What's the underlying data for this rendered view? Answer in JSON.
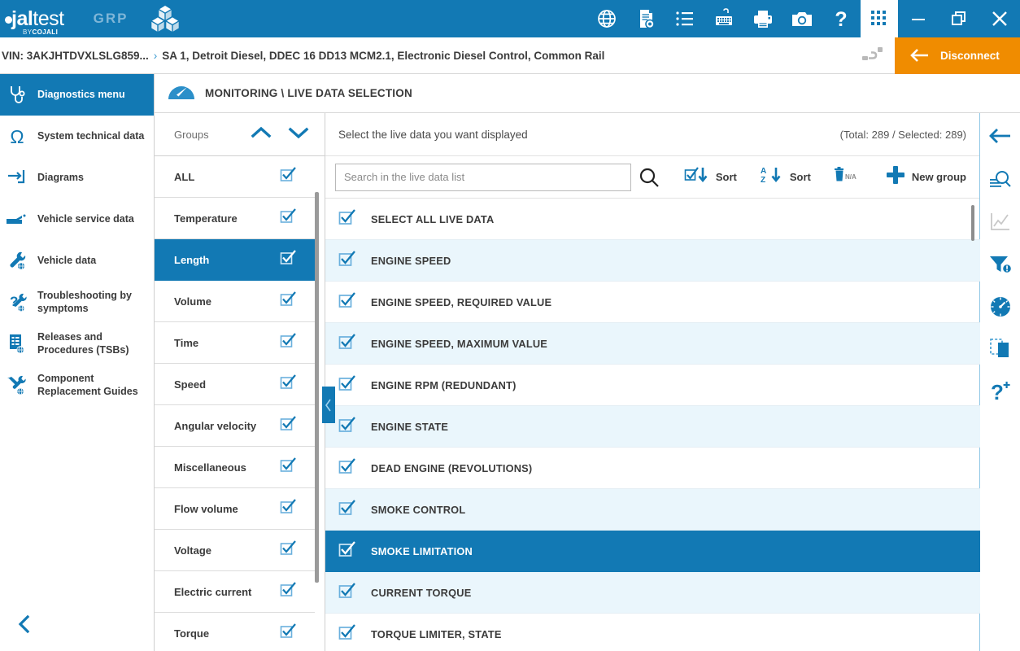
{
  "brand": {
    "logo_dot": "●",
    "logo_bold": "jal",
    "logo_light": "test",
    "logo_by": "BY",
    "logo_cojali": "COJALI",
    "grp": "GRP"
  },
  "titlebar": {
    "icons": [
      {
        "name": "globe-icon",
        "label": "Language"
      },
      {
        "name": "document-search-icon",
        "label": "Documents"
      },
      {
        "name": "list-icon",
        "label": "List"
      },
      {
        "name": "keyboard-icon",
        "label": "Virtual keyboard"
      },
      {
        "name": "printer-icon",
        "label": "Print"
      },
      {
        "name": "camera-icon",
        "label": "Screenshot"
      },
      {
        "name": "help-icon",
        "label": "Help"
      },
      {
        "name": "apps-grid-icon",
        "label": "Apps"
      }
    ],
    "window_controls": [
      {
        "name": "minimize-button",
        "label": "Minimize"
      },
      {
        "name": "restore-button",
        "label": "Restore"
      },
      {
        "name": "close-button",
        "label": "Close"
      }
    ]
  },
  "breadcrumb": {
    "vin": "VIN: 3AKJHTDVXLSLG859...",
    "separator": "›",
    "system": "SA 1, Detroit Diesel, DDEC 16 DD13 MCM2.1, Electronic Diesel Control, Common Rail",
    "connection_icon": "obd-connector-icon",
    "disconnect_label": "Disconnect"
  },
  "sidebar": {
    "items": [
      {
        "label": "Diagnostics menu",
        "icon": "stethoscope-icon",
        "active": true
      },
      {
        "label": "System technical data",
        "icon": "ohm-icon",
        "active": false
      },
      {
        "label": "Diagrams",
        "icon": "diagram-icon",
        "active": false
      },
      {
        "label": "Vehicle service data",
        "icon": "oil-can-icon",
        "active": false
      },
      {
        "label": "Vehicle data",
        "icon": "wrench-globe-icon",
        "active": false
      },
      {
        "label": "Troubleshooting by symptoms",
        "icon": "question-wrench-icon",
        "active": false
      },
      {
        "label": "Releases and Procedures (TSBs)",
        "icon": "document-globe-icon",
        "active": false
      },
      {
        "label": "Component Replacement Guides",
        "icon": "tools-globe-icon",
        "active": false
      }
    ],
    "collapse_icon": "chevron-left-icon"
  },
  "monitoring": {
    "icon": "gauge-icon",
    "title": "MONITORING \\ LIVE DATA SELECTION"
  },
  "groups_panel": {
    "header_label": "Groups",
    "scroll_up_icon": "chevron-up-icon",
    "scroll_down_icon": "chevron-down-icon",
    "items": [
      {
        "label": "ALL",
        "checked": true,
        "active": false
      },
      {
        "label": "Temperature",
        "checked": true,
        "active": false
      },
      {
        "label": "Length",
        "checked": true,
        "active": true
      },
      {
        "label": "Volume",
        "checked": true,
        "active": false
      },
      {
        "label": "Time",
        "checked": true,
        "active": false
      },
      {
        "label": "Speed",
        "checked": true,
        "active": false
      },
      {
        "label": "Angular velocity",
        "checked": true,
        "active": false
      },
      {
        "label": "Miscellaneous",
        "checked": true,
        "active": false
      },
      {
        "label": "Flow volume",
        "checked": true,
        "active": false
      },
      {
        "label": "Voltage",
        "checked": true,
        "active": false
      },
      {
        "label": "Electric current",
        "checked": true,
        "active": false
      },
      {
        "label": "Torque",
        "checked": true,
        "active": false
      }
    ]
  },
  "main_panel": {
    "instruction": "Select the live data you want displayed",
    "count_text": "(Total: 289 / Selected: 289)",
    "search_placeholder": "Search in the live data list",
    "search_value": "",
    "search_icon": "magnifier-icon",
    "tools": [
      {
        "label": "Sort",
        "icon": "sort-by-check-icon",
        "name": "sort-by-selection-button"
      },
      {
        "label": "Sort",
        "icon": "sort-alpha-icon",
        "name": "sort-alphabetical-button"
      },
      {
        "label": "",
        "icon": "trash-na-icon",
        "name": "delete-group-button",
        "badge": "N/A"
      },
      {
        "label": "New group",
        "icon": "plus-icon",
        "name": "new-group-button"
      }
    ],
    "collapse_handle_icon": "chevron-left-icon",
    "rows": [
      {
        "label": "SELECT ALL LIVE DATA",
        "checked": true,
        "shade": false,
        "selected": false
      },
      {
        "label": "ENGINE SPEED",
        "checked": true,
        "shade": true,
        "selected": false
      },
      {
        "label": "ENGINE SPEED, REQUIRED VALUE",
        "checked": true,
        "shade": false,
        "selected": false
      },
      {
        "label": "ENGINE SPEED, MAXIMUM VALUE",
        "checked": true,
        "shade": true,
        "selected": false
      },
      {
        "label": "ENGINE RPM (REDUNDANT)",
        "checked": true,
        "shade": false,
        "selected": false
      },
      {
        "label": "ENGINE STATE",
        "checked": true,
        "shade": true,
        "selected": false
      },
      {
        "label": "DEAD ENGINE (REVOLUTIONS)",
        "checked": true,
        "shade": false,
        "selected": false
      },
      {
        "label": "SMOKE CONTROL",
        "checked": true,
        "shade": true,
        "selected": false
      },
      {
        "label": "SMOKE LIMITATION",
        "checked": true,
        "shade": false,
        "selected": true
      },
      {
        "label": "CURRENT TORQUE",
        "checked": true,
        "shade": true,
        "selected": false
      },
      {
        "label": "TORQUE LIMITER, STATE",
        "checked": true,
        "shade": false,
        "selected": false
      }
    ]
  },
  "right_rail": {
    "items": [
      {
        "name": "back-arrow-icon",
        "label": "Back",
        "disabled": false
      },
      {
        "name": "search-lines-icon",
        "label": "Search",
        "disabled": false
      },
      {
        "name": "chart-icon",
        "label": "Graph",
        "disabled": true
      },
      {
        "name": "filter-alert-icon",
        "label": "Filter",
        "disabled": false
      },
      {
        "name": "gauge-dial-icon",
        "label": "Measurements",
        "disabled": false
      },
      {
        "name": "copy-icon",
        "label": "Copy",
        "disabled": false
      },
      {
        "name": "question-plus-icon",
        "label": "Help",
        "disabled": false
      }
    ]
  },
  "colors": {
    "brand_blue": "#1279b4",
    "orange": "#f08c00",
    "row_shade": "#eaf6fc",
    "check_blue": "#3a9ad0"
  }
}
